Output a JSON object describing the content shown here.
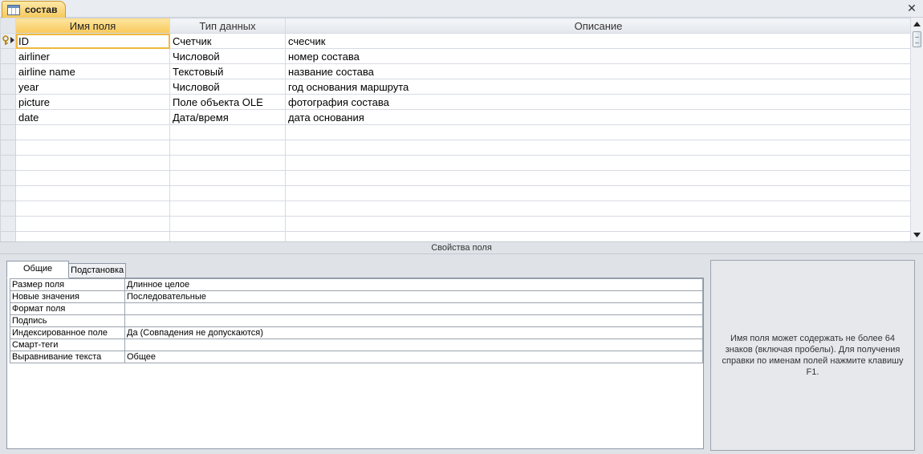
{
  "document_tab": {
    "label": "состав",
    "icon": "table-icon"
  },
  "grid": {
    "columns": [
      {
        "key": "name",
        "label": "Имя поля"
      },
      {
        "key": "type",
        "label": "Тип данных"
      },
      {
        "key": "description",
        "label": "Описание"
      }
    ],
    "rows": [
      {
        "name": "ID",
        "type": "Счетчик",
        "description": "счесчик",
        "primary_key": true
      },
      {
        "name": "airliner",
        "type": "Числовой",
        "description": "номер состава"
      },
      {
        "name": "airline name",
        "type": "Текстовый",
        "description": "название состава"
      },
      {
        "name": "year",
        "type": "Числовой",
        "description": "год основания маршрута"
      },
      {
        "name": "picture",
        "type": "Поле объекта OLE",
        "description": "фотография состава"
      },
      {
        "name": "date",
        "type": "Дата/время",
        "description": "дата основания"
      }
    ]
  },
  "field_properties": {
    "title": "Свойства поля",
    "tabs": [
      {
        "label": "Общие",
        "active": true
      },
      {
        "label": "Подстановка",
        "active": false
      }
    ],
    "properties": [
      {
        "label": "Размер поля",
        "value": "Длинное целое"
      },
      {
        "label": "Новые значения",
        "value": "Последовательные"
      },
      {
        "label": "Формат поля",
        "value": ""
      },
      {
        "label": "Подпись",
        "value": ""
      },
      {
        "label": "Индексированное поле",
        "value": "Да (Совпадения не допускаются)"
      },
      {
        "label": "Смарт-теги",
        "value": ""
      },
      {
        "label": "Выравнивание текста",
        "value": "Общее"
      }
    ]
  },
  "help_text": "Имя поля может содержать не более 64 знаков (включая пробелы). Для получения справки по именам полей нажмите клавишу F1.",
  "colors": {
    "active_header": "#f8c85a",
    "grid_line": "#d6dbe2",
    "background": "#dfe3e8"
  }
}
